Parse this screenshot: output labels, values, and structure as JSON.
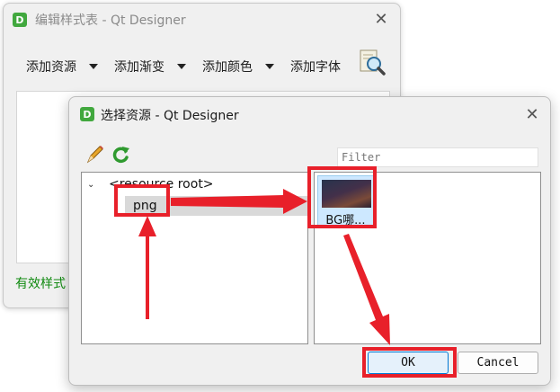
{
  "stylesheet_window": {
    "app_icon_letter": "D",
    "title": "编辑样式表 - Qt Designer",
    "close_glyph": "✕",
    "toolbar": [
      {
        "label": "添加资源",
        "icon": "dropdown-arrow"
      },
      {
        "label": "添加渐变",
        "icon": "dropdown-arrow"
      },
      {
        "label": "添加颜色",
        "icon": "dropdown-arrow"
      },
      {
        "label": "添加字体",
        "icon": ""
      }
    ],
    "toolbar_tool_icon": "magnifier-document-icon",
    "status_text": "有效样式"
  },
  "resource_dialog": {
    "app_icon_letter": "D",
    "title": "选择资源 - Qt Designer",
    "close_glyph": "✕",
    "edit_icon": "pencil-icon",
    "reload_icon": "refresh-icon",
    "filter_placeholder": "Filter",
    "tree": {
      "root_label": "<resource root>",
      "chevron": "⌄",
      "child_label": "png"
    },
    "file": {
      "name": "BG哪..."
    },
    "ok_label": "OK",
    "cancel_label": "Cancel"
  },
  "colors": {
    "annotation_red": "#e8202a",
    "status_green": "#118a11",
    "selection_blue": "#cde8ff",
    "qt_green": "#41a83e"
  }
}
